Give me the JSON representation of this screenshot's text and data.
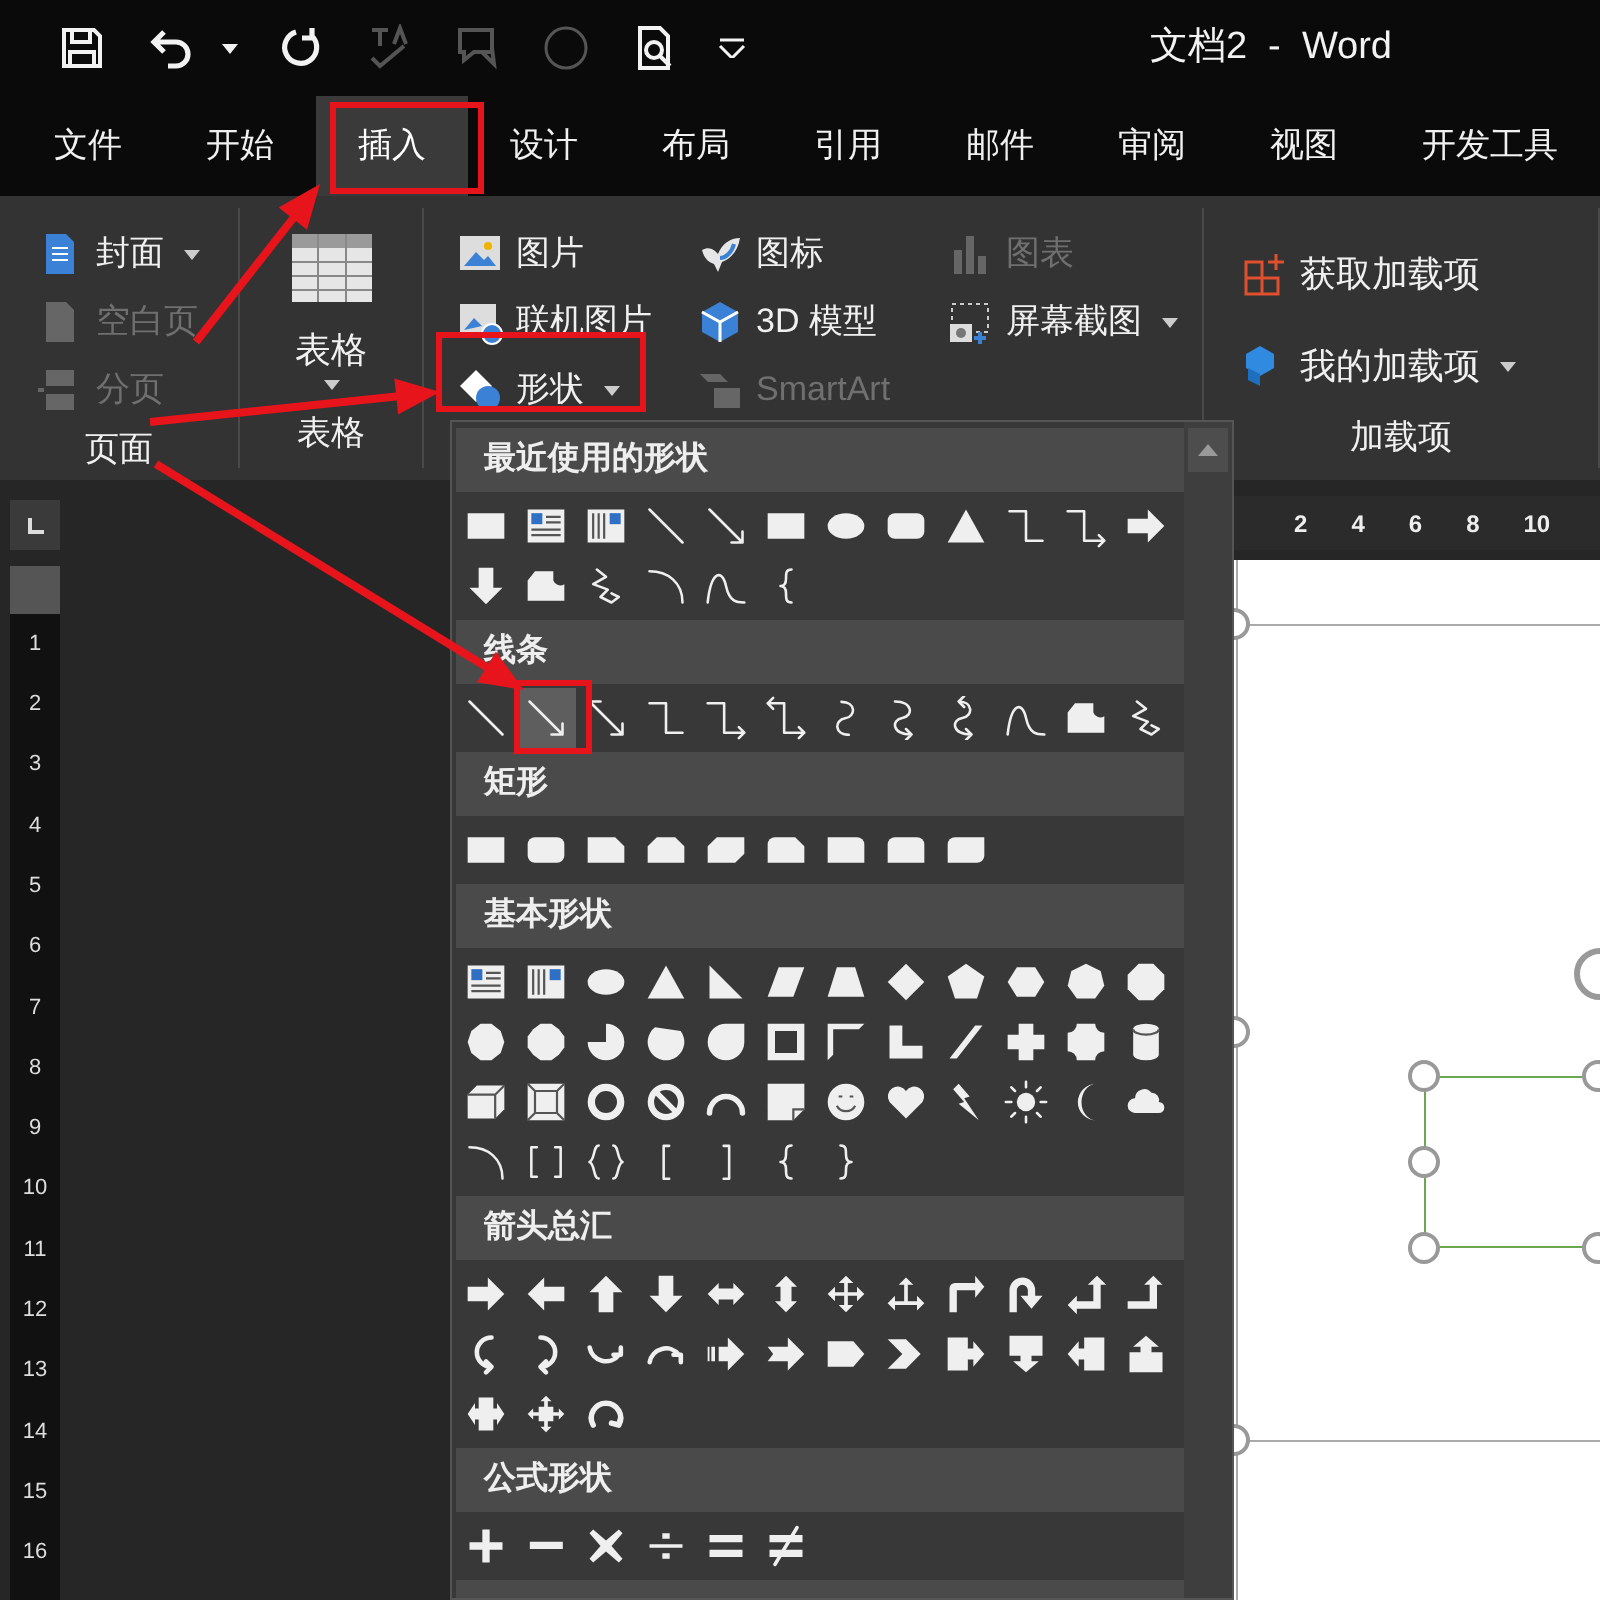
{
  "window": {
    "title": "文档2  -  Word"
  },
  "quick_access": [
    {
      "kind": "save",
      "disabled": false
    },
    {
      "kind": "undo",
      "disabled": false
    },
    {
      "kind": "caret",
      "disabled": false
    },
    {
      "kind": "redo",
      "disabled": false
    },
    {
      "kind": "spelling",
      "disabled": true
    },
    {
      "kind": "comment",
      "disabled": true
    },
    {
      "kind": "circle",
      "disabled": true
    },
    {
      "kind": "print-preview",
      "disabled": false
    },
    {
      "kind": "customize",
      "disabled": false
    }
  ],
  "menu_tabs": [
    {
      "label": "文件",
      "selected": false
    },
    {
      "label": "开始",
      "selected": false
    },
    {
      "label": "插入",
      "selected": true
    },
    {
      "label": "设计",
      "selected": false
    },
    {
      "label": "布局",
      "selected": false
    },
    {
      "label": "引用",
      "selected": false
    },
    {
      "label": "邮件",
      "selected": false
    },
    {
      "label": "审阅",
      "selected": false
    },
    {
      "label": "视图",
      "selected": false
    },
    {
      "label": "开发工具",
      "selected": false
    }
  ],
  "ribbon": {
    "groups": [
      {
        "label": "页面",
        "items": [
          {
            "kind": "cover-page",
            "label": "封面",
            "dropdown": true,
            "disabled": false
          },
          {
            "kind": "blank-page",
            "label": "空白页",
            "dropdown": false,
            "disabled": true
          },
          {
            "kind": "page-break",
            "label": "分页",
            "dropdown": false,
            "disabled": true
          }
        ]
      },
      {
        "label": "表格",
        "items": [
          {
            "kind": "table",
            "label": "表格",
            "dropdown": true,
            "disabled": false
          }
        ]
      },
      {
        "items": [
          {
            "kind": "picture",
            "label": "图片",
            "dropdown": false,
            "disabled": false
          },
          {
            "kind": "online-picture",
            "label": "联机图片",
            "dropdown": false,
            "disabled": false
          },
          {
            "kind": "shapes",
            "label": "形状",
            "dropdown": true,
            "disabled": false
          },
          {
            "kind": "icons",
            "label": "图标",
            "dropdown": false,
            "disabled": false
          },
          {
            "kind": "model-3d",
            "label": "3D 模型",
            "dropdown": false,
            "disabled": false
          },
          {
            "kind": "smartart",
            "label": "SmartArt",
            "dropdown": false,
            "disabled": true
          },
          {
            "kind": "chart",
            "label": "图表",
            "dropdown": false,
            "disabled": true
          },
          {
            "kind": "screenshot",
            "label": "屏幕截图",
            "dropdown": true,
            "disabled": false
          }
        ]
      },
      {
        "label": "加载项",
        "items": [
          {
            "kind": "store",
            "label": "获取加载项",
            "dropdown": false,
            "disabled": false
          },
          {
            "kind": "addins",
            "label": "我的加载项",
            "dropdown": true,
            "disabled": false
          }
        ]
      }
    ]
  },
  "shapes_gallery": {
    "sections": [
      {
        "title": "最近使用的形状",
        "shapes": [
          {
            "kind": "rect",
            "selected": false
          },
          {
            "kind": "textbox",
            "selected": false
          },
          {
            "kind": "vtextbox",
            "selected": false
          },
          {
            "kind": "line",
            "selected": false
          },
          {
            "kind": "arrow-line",
            "selected": false
          },
          {
            "kind": "rect",
            "selected": false
          },
          {
            "kind": "oval",
            "selected": false
          },
          {
            "kind": "rounded-rect",
            "selected": false
          },
          {
            "kind": "triangle",
            "selected": false
          },
          {
            "kind": "elbow",
            "selected": false
          },
          {
            "kind": "elbow-arrow",
            "selected": false
          },
          {
            "kind": "right-arrow",
            "selected": false
          },
          {
            "kind": "down-arrow",
            "selected": false
          },
          {
            "kind": "freeform-shape",
            "selected": false
          },
          {
            "kind": "scribble",
            "selected": false
          },
          {
            "kind": "arc",
            "selected": false
          },
          {
            "kind": "wave-curve",
            "selected": false
          },
          {
            "kind": "left-brace",
            "selected": false
          }
        ]
      },
      {
        "title": "线条",
        "shapes": [
          {
            "kind": "line",
            "selected": false
          },
          {
            "kind": "arrow-line",
            "selected": true
          },
          {
            "kind": "double-arrow-line",
            "selected": false
          },
          {
            "kind": "elbow",
            "selected": false
          },
          {
            "kind": "elbow-arrow",
            "selected": false
          },
          {
            "kind": "elbow-double-arrow",
            "selected": false
          },
          {
            "kind": "curve",
            "selected": false
          },
          {
            "kind": "curve-arrow",
            "selected": false
          },
          {
            "kind": "curve-double-arrow",
            "selected": false
          },
          {
            "kind": "wave-curve",
            "selected": false
          },
          {
            "kind": "freeform-shape",
            "selected": false
          },
          {
            "kind": "scribble",
            "selected": false
          }
        ]
      },
      {
        "title": "矩形",
        "shapes": [
          {
            "kind": "rect",
            "selected": false
          },
          {
            "kind": "rounded-rect",
            "selected": false
          },
          {
            "kind": "snip-rect",
            "selected": false
          },
          {
            "kind": "snip-top-rect",
            "selected": false
          },
          {
            "kind": "snip-diag-rect",
            "selected": false
          },
          {
            "kind": "snip-round-rect",
            "selected": false
          },
          {
            "kind": "round-corner-rect",
            "selected": false
          },
          {
            "kind": "round-top-rect",
            "selected": false
          },
          {
            "kind": "round-diag-rect",
            "selected": false
          }
        ]
      },
      {
        "title": "基本形状",
        "shapes": [
          {
            "kind": "textbox",
            "selected": false
          },
          {
            "kind": "vtextbox",
            "selected": false
          },
          {
            "kind": "oval",
            "selected": false
          },
          {
            "kind": "triangle",
            "selected": false
          },
          {
            "kind": "right-triangle",
            "selected": false
          },
          {
            "kind": "parallelogram",
            "selected": false
          },
          {
            "kind": "trapezoid",
            "selected": false
          },
          {
            "kind": "diamond",
            "selected": false
          },
          {
            "kind": "pentagon",
            "selected": false
          },
          {
            "kind": "hexagon",
            "selected": false
          },
          {
            "kind": "heptagon",
            "selected": false
          },
          {
            "kind": "octagon",
            "selected": false
          },
          {
            "kind": "decagon",
            "selected": false
          },
          {
            "kind": "dodecagon",
            "selected": false
          },
          {
            "kind": "pie",
            "selected": false
          },
          {
            "kind": "chord",
            "selected": false
          },
          {
            "kind": "teardrop",
            "selected": false
          },
          {
            "kind": "frame",
            "selected": false
          },
          {
            "kind": "half-frame",
            "selected": false
          },
          {
            "kind": "l-shape",
            "selected": false
          },
          {
            "kind": "diagonal-stripe",
            "selected": false
          },
          {
            "kind": "cross",
            "selected": false
          },
          {
            "kind": "plaque",
            "selected": false
          },
          {
            "kind": "can",
            "selected": false
          },
          {
            "kind": "cube",
            "selected": false
          },
          {
            "kind": "bevel",
            "selected": false
          },
          {
            "kind": "donut",
            "selected": false
          },
          {
            "kind": "no-symbol",
            "selected": false
          },
          {
            "kind": "block-arc",
            "selected": false
          },
          {
            "kind": "folded-corner",
            "selected": false
          },
          {
            "kind": "smiley",
            "selected": false
          },
          {
            "kind": "heart",
            "selected": false
          },
          {
            "kind": "lightning",
            "selected": false
          },
          {
            "kind": "sun",
            "selected": false
          },
          {
            "kind": "moon",
            "selected": false
          },
          {
            "kind": "cloud",
            "selected": false
          },
          {
            "kind": "arc",
            "selected": false
          },
          {
            "kind": "bracket-pair",
            "selected": false
          },
          {
            "kind": "brace-pair",
            "selected": false
          },
          {
            "kind": "left-bracket",
            "selected": false
          },
          {
            "kind": "right-bracket",
            "selected": false
          },
          {
            "kind": "left-brace",
            "selected": false
          },
          {
            "kind": "right-brace",
            "selected": false
          }
        ]
      },
      {
        "title": "箭头总汇",
        "shapes": [
          {
            "kind": "right-arrow",
            "selected": false
          },
          {
            "kind": "left-arrow",
            "selected": false
          },
          {
            "kind": "up-arrow",
            "selected": false
          },
          {
            "kind": "down-arrow",
            "selected": false
          },
          {
            "kind": "left-right-arrow",
            "selected": false
          },
          {
            "kind": "up-down-arrow",
            "selected": false
          },
          {
            "kind": "quad-arrow",
            "selected": false
          },
          {
            "kind": "left-right-up-arrow",
            "selected": false
          },
          {
            "kind": "bent-arrow",
            "selected": false
          },
          {
            "kind": "u-turn-arrow",
            "selected": false
          },
          {
            "kind": "left-up-arrow",
            "selected": false
          },
          {
            "kind": "bent-up-arrow",
            "selected": false
          },
          {
            "kind": "curved-right-arrow",
            "selected": false
          },
          {
            "kind": "curved-left-arrow",
            "selected": false
          },
          {
            "kind": "curved-up-arrow",
            "selected": false
          },
          {
            "kind": "curved-down-arrow",
            "selected": false
          },
          {
            "kind": "striped-right-arrow",
            "selected": false
          },
          {
            "kind": "notched-right-arrow",
            "selected": false
          },
          {
            "kind": "pentagon-arrow",
            "selected": false
          },
          {
            "kind": "chevron",
            "selected": false
          },
          {
            "kind": "right-arrow-callout",
            "selected": false
          },
          {
            "kind": "down-arrow-callout",
            "selected": false
          },
          {
            "kind": "left-arrow-callout",
            "selected": false
          },
          {
            "kind": "up-arrow-callout",
            "selected": false
          },
          {
            "kind": "left-right-arrow-callout",
            "selected": false
          },
          {
            "kind": "quad-arrow-callout",
            "selected": false
          },
          {
            "kind": "circular-arrow",
            "selected": false
          }
        ]
      },
      {
        "title": "公式形状",
        "shapes": [
          {
            "kind": "plus",
            "selected": false
          },
          {
            "kind": "minus",
            "selected": false
          },
          {
            "kind": "multiply",
            "selected": false
          },
          {
            "kind": "divide",
            "selected": false
          },
          {
            "kind": "equal",
            "selected": false
          },
          {
            "kind": "not-equal",
            "selected": false
          }
        ]
      }
    ]
  },
  "horizontal_ruler": {
    "labels": [
      "2",
      "4",
      "6",
      "8",
      "10"
    ]
  },
  "vertical_ruler": {
    "labels": [
      "1",
      "2",
      "3",
      "4",
      "5",
      "6",
      "7",
      "8",
      "9",
      "10",
      "11",
      "12",
      "13",
      "14",
      "15",
      "16"
    ]
  }
}
